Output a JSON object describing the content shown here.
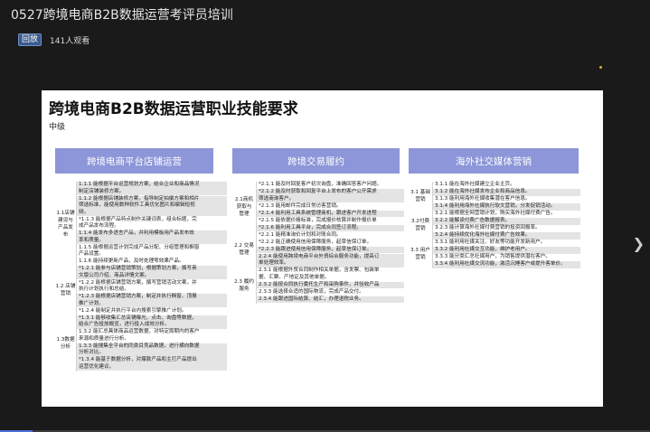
{
  "window": {
    "title": "0527跨境电商B2B数据运营考评员培训"
  },
  "meta": {
    "replay_badge": "回放",
    "viewers": "141人观看"
  },
  "slide": {
    "title": "跨境电商B2B数据运营职业技能要求",
    "level": "中级",
    "columns": [
      {
        "header": "跨境电商平台店铺运营",
        "sections": [
          {
            "label": "1.1店铺\n建设与\n产品发\n布",
            "items": [
              "1.1.1 能根据平台运营规划方案，结合企业和商品情况\n制定店铺装修方案。",
              "1.1.2 能根据店铺装修方案，指导制定拍摄方案和相片\n筛选标准，能使用数种软件工具优化图片和编辑短视\n频。",
              "*1.1.3 能根据产品特点制作关键词表，组合标题，完\n成产品发布流程。",
              "1.1.4 能发布多语言产品，并利用模板用产品发布效\n率和质量。",
              "1.1.5 能根据运营计划完成产品分配、分组管理和橱窗\n产品设置。",
              "1.1.6 能持续更新产品，及时处理零效果产品。"
            ]
          },
          {
            "label": "1.2 店铺\n营销",
            "items": [
              "*1.2.1 能参与店铺营销策划，根据策划方案，撰写英\n文版公司介绍、商品详情文案。",
              "*1.2.2 能根据店铺营销方案，撰写营销活动文案，并\n执行计划执行和总结。",
              "*1.2.3 能根据店铺营销方案，制定并执行橱窗、顶展\n推广计划。",
              "*1.2.4 能制定并执行平台内搜索引擎推广计划。"
            ]
          },
          {
            "label": "1.3数据\n分析",
            "items": [
              "*1.3.1 能够收集汇总店铺曝光、点击、询盘等数据，\n结合广告投放概览，进行投入成效分析。",
              "1.3.2 能汇总具体商品运营数据，对特定周期内的客户\n来源和质量进行分析。",
              "1.3.3 能搜集全平台的同类目竞品数据，进行横向数据\n分析对比。",
              "*1.3.4 能基于数据分析，对爆款产品和主打产品提出\n运营优化建议。"
            ]
          }
        ]
      },
      {
        "header": "跨境交易履约",
        "sections": [
          {
            "label": "2.1商机\n获取与\n管理",
            "items": [
              "*2.1.1 能及时回复客户初次询盘，准确回答客户问题。",
              "*2.1.2 能及时获取和回复平台上发布的客户公开需求\n筛选商询客户。",
              "*2.1.3 能用邮件完成日常访客营销。",
              "*2.1.4 能利用工具系统管理商机，跟进客户开发进程",
              "*2.1.5 能依据价格标准，完成报价核算并制作报价单",
              "*2.1.6 能利用工具平台，完成合同签订流程。"
            ]
          },
          {
            "label": "2.2 交易\n管理",
            "items": [
              "*2.2.1 能精准询价计划和对账合同。",
              "*2.2.2 能正确使用信用保障服务，起草信保订单。",
              "*2.2.3 能跟进使用信用保障服务，起草信保订单。",
              "2.2.4 能使用跨境电商平台外贸综合服务功能，提高订\n单处理效率。"
            ]
          },
          {
            "label": "2.3 履约\n服务",
            "items": [
              "2.3.1 能根据外贸合同制作相关单据，含发票、包装单\n据、汇票、产地证及其他单据。",
              "2.3.2 能按合同执行委托生产和采购事件，并验收产品",
              "2.3.3 能选择合适的国际物流，完成产品交付。",
              "2.3.4 能跟进国际结算、结汇，办理退税业务。"
            ]
          }
        ]
      },
      {
        "header": "海外社交媒体营销",
        "sections": [
          {
            "label": "3.1 基础\n营销",
            "items": [
              "3.1.1 能在海外社媒建立企业主页。",
              "3.1.2 能在海外社媒发布企业和商品信息。",
              "3.1.3 能利用海外社媒收集潜在客户信息。",
              "3.1.4 能利用海外社媒执行软文营销，分发促销活动。"
            ]
          },
          {
            "label": "3.2付费\n营销",
            "items": [
              "3.2.1 能根据全网营销计划，购买海外社媒付费广告。",
              "3.2.2 能解读付费广告数据报表。",
              "3.2.3 能计算海外社媒付费营销的投资回报率。",
              "3.2.4 能持续优化海外社媒付费广告效果。"
            ]
          },
          {
            "label": "3.3 用户\n营销",
            "items": [
              "3.3.1 能利用社媒关注、好友等功能开发新用户。",
              "3.3.2 能利用社媒交互功能，维护老用户。",
              "3.3.3 能分类汇总社媒用户，为销售提供潜在客户。",
              "3.3.4 能利用社媒交流功能，激活沉睡客户或提升客单价。"
            ]
          }
        ]
      }
    ]
  },
  "playback": {
    "progress": 0.05
  }
}
